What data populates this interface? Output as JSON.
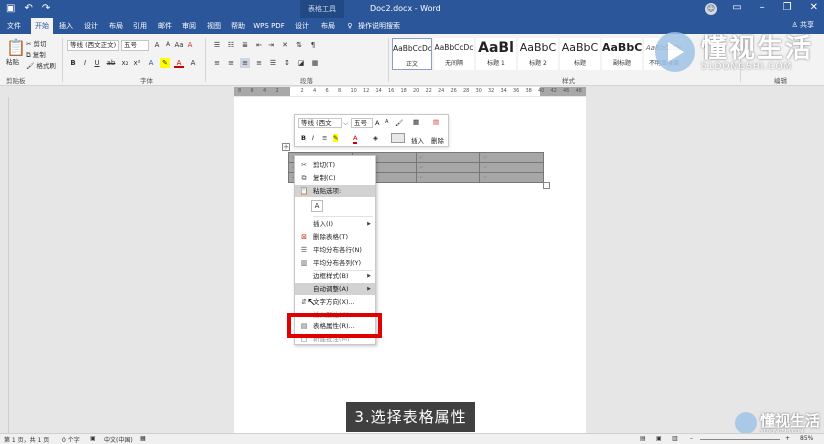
{
  "titlebar": {
    "context_tool": "表格工具",
    "doc_title": "Doc2.docx - Word",
    "quick_access": {
      "save_icon": "save-icon",
      "undo_icon": "undo-icon",
      "redo_icon": "redo-icon"
    },
    "window_controls": [
      "minimize",
      "restore",
      "close"
    ]
  },
  "tabs": {
    "items": [
      "文件",
      "开始",
      "插入",
      "设计",
      "布局",
      "引用",
      "邮件",
      "审阅",
      "视图",
      "帮助",
      "WPS PDF",
      "设计",
      "布局"
    ],
    "active": "开始",
    "tell_me": "操作说明搜索",
    "share": "共享"
  },
  "ribbon": {
    "clipboard": {
      "paste": "粘贴",
      "cut": "剪切",
      "copy": "复制",
      "format_painter": "格式刷",
      "label": "剪贴板"
    },
    "font": {
      "font_name": "等线 (西文正文)",
      "font_size": "五号",
      "label": "字体"
    },
    "paragraph": {
      "label": "段落"
    },
    "styles": {
      "label": "样式",
      "items": [
        {
          "sample": "AaBbCcDc",
          "name": "正文"
        },
        {
          "sample": "AaBbCcDc",
          "name": "无间隔"
        },
        {
          "sample": "AaBl",
          "name": "标题 1"
        },
        {
          "sample": "AaBbC",
          "name": "标题 2"
        },
        {
          "sample": "AaBbC",
          "name": "标题"
        },
        {
          "sample": "AaBbC",
          "name": "副标题"
        },
        {
          "sample": "AaBbCcDc",
          "name": "不明显强调"
        }
      ]
    },
    "editing": {
      "label": "编辑"
    }
  },
  "ruler": {
    "ticks": [
      "8",
      "6",
      "4",
      "2",
      "",
      "2",
      "4",
      "6",
      "8",
      "10",
      "12",
      "14",
      "16",
      "18",
      "20",
      "22",
      "24",
      "26",
      "28",
      "30",
      "32",
      "34",
      "36",
      "38",
      "40",
      "42",
      "46",
      "48"
    ]
  },
  "mini_toolbar": {
    "font_name": "等线 (西文",
    "font_size": "五号",
    "insert": "插入",
    "delete": "删除"
  },
  "table": {
    "rows": 3,
    "cols": 4,
    "cell_mark": "↵"
  },
  "context_menu": {
    "items": [
      {
        "label": "剪切(T)",
        "icon": "scissors-icon"
      },
      {
        "label": "复制(C)",
        "icon": "copy-icon"
      },
      {
        "label": "粘贴选项:",
        "icon": "paste-icon"
      },
      {
        "label": "插入(I)",
        "icon": "",
        "submenu": true
      },
      {
        "label": "删除表格(T)",
        "icon": "delete-table-icon"
      },
      {
        "label": "平均分布各行(N)",
        "icon": "distribute-rows-icon"
      },
      {
        "label": "平均分布各列(Y)",
        "icon": "distribute-columns-icon"
      },
      {
        "label": "边框样式(B)",
        "icon": "",
        "submenu": true
      },
      {
        "label": "自动调整(A)",
        "icon": "",
        "submenu": true,
        "hovered": true
      },
      {
        "label": "文字方向(X)...",
        "icon": "text-direction-icon"
      },
      {
        "label": "插入题注(C)...",
        "icon": "caption-icon",
        "faded": true
      },
      {
        "label": "表格属性(R)...",
        "icon": "table-properties-icon"
      },
      {
        "label": "新建批注(M)",
        "icon": "comment-icon",
        "faded": true
      }
    ]
  },
  "caption": "3.选择表格属性",
  "status": {
    "page": "第 1 页，共 1 页",
    "words": "0 个字",
    "language": "中文(中国)",
    "zoom": "85%"
  },
  "watermark": {
    "main": "懂视生活",
    "sub": "51DONGSHI.COM"
  }
}
